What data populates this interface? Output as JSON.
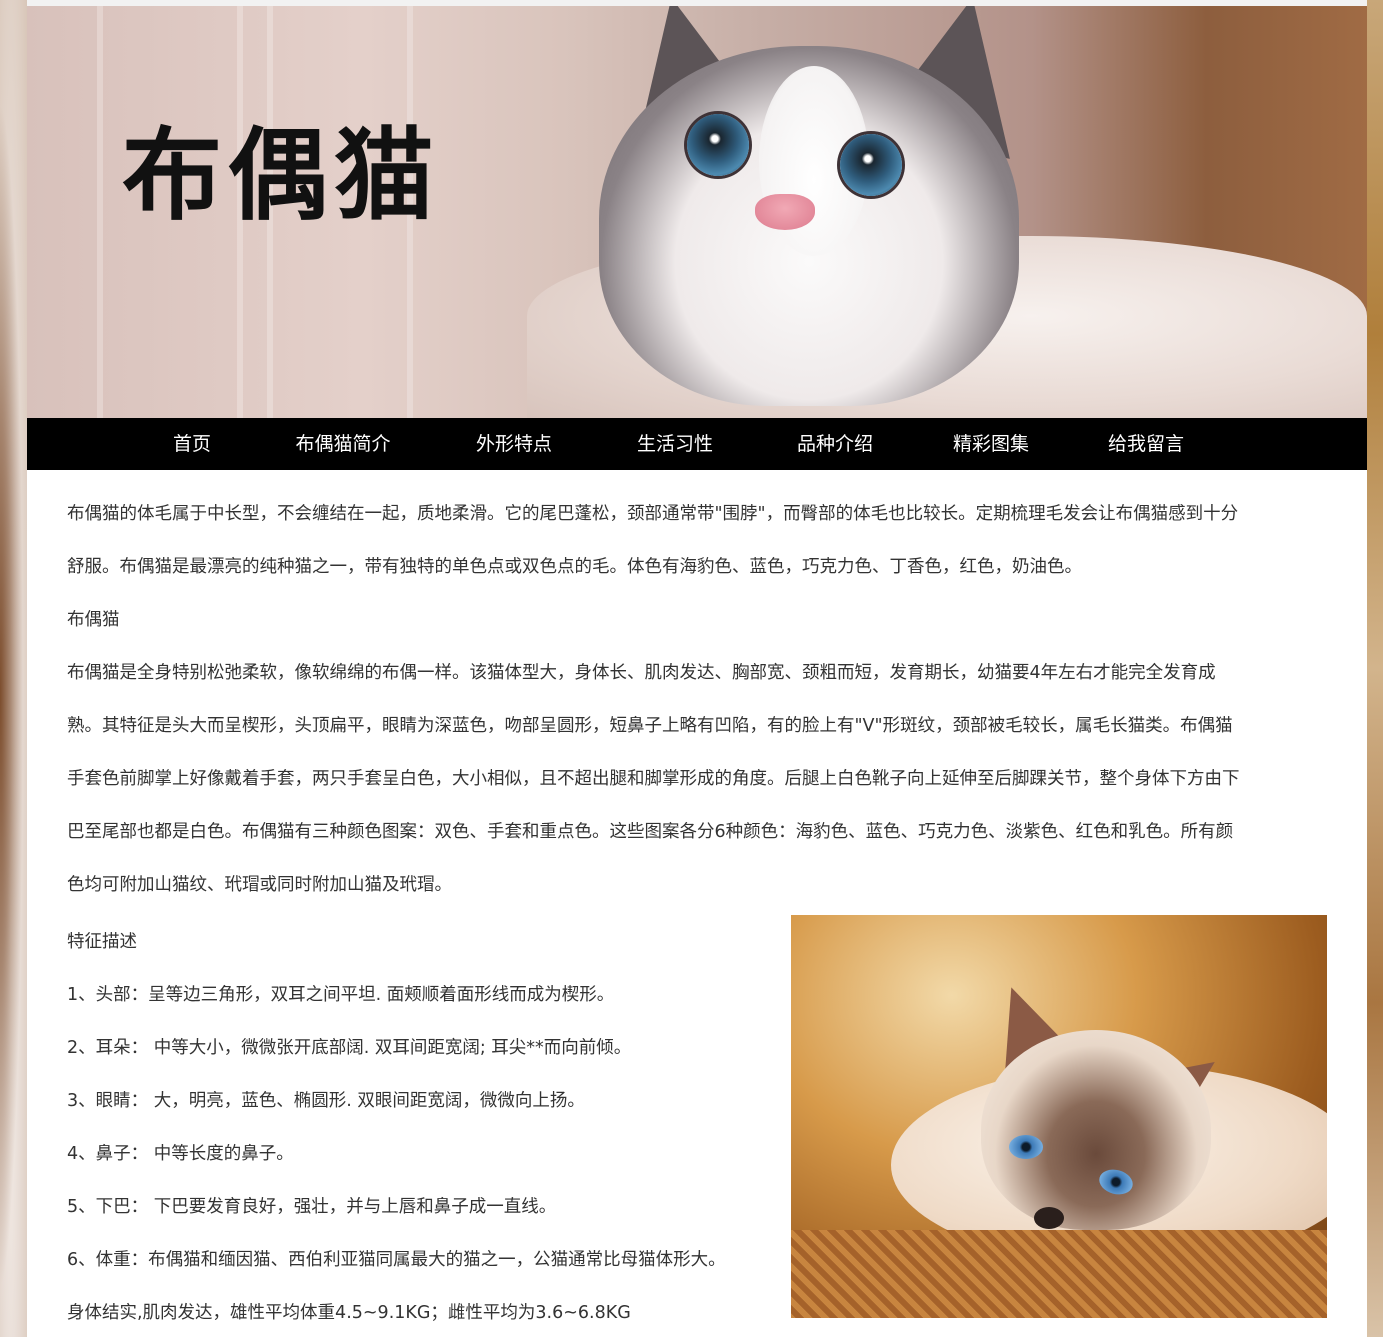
{
  "banner": {
    "title": "布偶猫"
  },
  "nav": {
    "items": [
      "首页",
      "布偶猫简介",
      "外形特点",
      "生活习性",
      "品种介绍",
      "精彩图集",
      "给我留言"
    ]
  },
  "content": {
    "para1": "布偶猫的体毛属于中长型，不会缠结在一起，质地柔滑。它的尾巴蓬松，颈部通常带\"围脖\"，而臀部的体毛也比较长。定期梳理毛发会让布偶猫感到十分",
    "para1b": "舒服。布偶猫是最漂亮的纯种猫之一，带有独特的单色点或双色点的毛。体色有海豹色、蓝色，巧克力色、丁香色，红色，奶油色。",
    "subtitle1": "布偶猫",
    "para2a": "布偶猫是全身特别松弛柔软，像软绵绵的布偶一样。该猫体型大，身体长、肌肉发达、胸部宽、颈粗而短，发育期长，幼猫要4年左右才能完全发育成",
    "para2b": "熟。其特征是头大而呈楔形，头顶扁平，眼睛为深蓝色，吻部呈圆形，短鼻子上略有凹陷，有的脸上有\"V\"形斑纹，颈部被毛较长，属毛长猫类。布偶猫",
    "para2c": "手套色前脚掌上好像戴着手套，两只手套呈白色，大小相似，且不超出腿和脚掌形成的角度。后腿上白色靴子向上延伸至后脚踝关节，整个身体下方由下",
    "para2d": "巴至尾部也都是白色。布偶猫有三种颜色图案：双色、手套和重点色。这些图案各分6种颜色：海豹色、蓝色、巧克力色、淡紫色、红色和乳色。所有颜",
    "para2e": "色均可附加山猫纹、玳瑁或同时附加山猫及玳瑁。",
    "subtitle2": "特征描述",
    "features": [
      "1、头部：呈等边三角形，双耳之间平坦. 面颊顺着面形线而成为楔形。",
      "2、耳朵： 中等大小，微微张开底部阔. 双耳间距宽阔; 耳尖**而向前倾。",
      "3、眼睛： 大，明亮，蓝色、椭圆形. 双眼间距宽阔，微微向上扬。",
      "4、鼻子： 中等长度的鼻子。",
      "5、下巴： 下巴要发育良好，强壮，并与上唇和鼻子成一直线。",
      "6、体重：布偶猫和缅因猫、西伯利亚猫同属最大的猫之一，公猫通常比母猫体形大。",
      "身体结实,肌肉发达，雄性平均体重4.5~9.1KG；雌性平均为3.6~6.8KG"
    ]
  }
}
